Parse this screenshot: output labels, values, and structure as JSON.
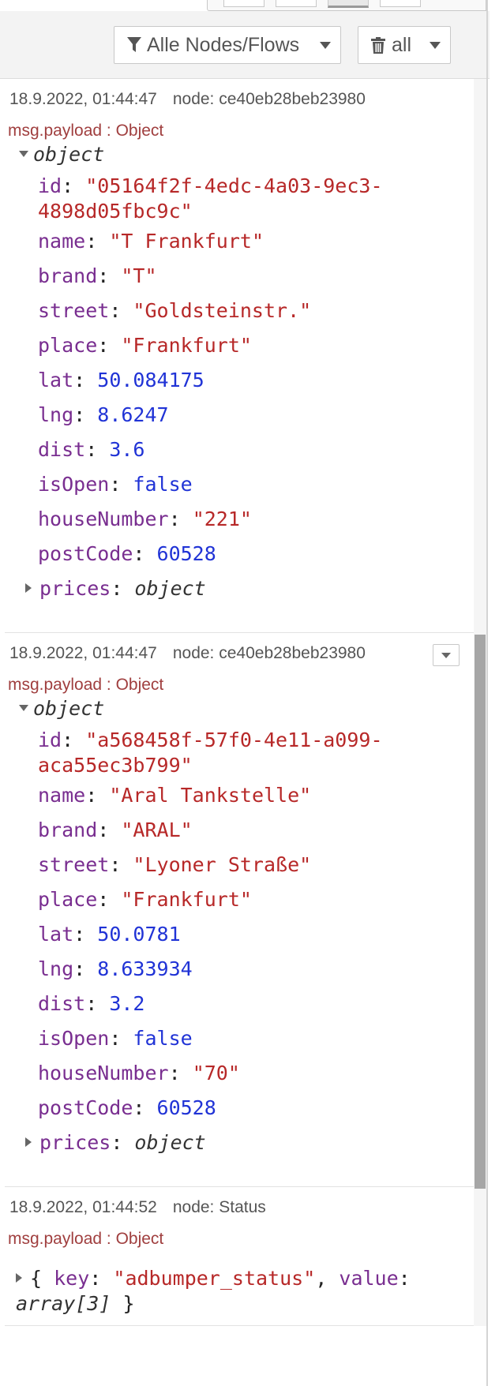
{
  "toolbar": {
    "filter_label": "Alle Nodes/Flows",
    "clear_label": "all"
  },
  "messages": [
    {
      "timestamp": "18.9.2022, 01:44:47",
      "node": "node: ce40eb28beb23980",
      "payload_type": "msg.payload : Object",
      "object_label": "object",
      "fields": [
        {
          "key": "id",
          "value": "\"05164f2f-4edc-4a03-9ec3-4898d05fbc9c\"",
          "kind": "string"
        },
        {
          "key": "name",
          "value": "\"T Frankfurt\"",
          "kind": "string"
        },
        {
          "key": "brand",
          "value": "\"T\"",
          "kind": "string"
        },
        {
          "key": "street",
          "value": "\"Goldsteinstr.\"",
          "kind": "string"
        },
        {
          "key": "place",
          "value": "\"Frankfurt\"",
          "kind": "string"
        },
        {
          "key": "lat",
          "value": "50.084175",
          "kind": "number"
        },
        {
          "key": "lng",
          "value": "8.6247",
          "kind": "number"
        },
        {
          "key": "dist",
          "value": "3.6",
          "kind": "number"
        },
        {
          "key": "isOpen",
          "value": "false",
          "kind": "boolean"
        },
        {
          "key": "houseNumber",
          "value": "\"221\"",
          "kind": "string"
        },
        {
          "key": "postCode",
          "value": "60528",
          "kind": "number"
        },
        {
          "key": "prices",
          "value": "object",
          "kind": "type"
        }
      ]
    },
    {
      "timestamp": "18.9.2022, 01:44:47",
      "node": "node: ce40eb28beb23980",
      "payload_type": "msg.payload : Object",
      "object_label": "object",
      "fields": [
        {
          "key": "id",
          "value": "\"a568458f-57f0-4e11-a099-aca55ec3b799\"",
          "kind": "string"
        },
        {
          "key": "name",
          "value": "\"Aral Tankstelle\"",
          "kind": "string"
        },
        {
          "key": "brand",
          "value": "\"ARAL\"",
          "kind": "string"
        },
        {
          "key": "street",
          "value": "\"Lyoner Straße\"",
          "kind": "string"
        },
        {
          "key": "place",
          "value": "\"Frankfurt\"",
          "kind": "string"
        },
        {
          "key": "lat",
          "value": "50.0781",
          "kind": "number"
        },
        {
          "key": "lng",
          "value": "8.633934",
          "kind": "number"
        },
        {
          "key": "dist",
          "value": "3.2",
          "kind": "number"
        },
        {
          "key": "isOpen",
          "value": "false",
          "kind": "boolean"
        },
        {
          "key": "houseNumber",
          "value": "\"70\"",
          "kind": "string"
        },
        {
          "key": "postCode",
          "value": "60528",
          "kind": "number"
        },
        {
          "key": "prices",
          "value": "object",
          "kind": "type"
        }
      ]
    },
    {
      "timestamp": "18.9.2022, 01:44:52",
      "node": "node: Status",
      "payload_type": "msg.payload : Object",
      "summary": {
        "open_brace": "{",
        "key1": "key",
        "value1": "\"adbumper_status\"",
        "sep": ",",
        "key2": "value",
        "value2": "array[3]",
        "close_brace": "}"
      }
    }
  ]
}
